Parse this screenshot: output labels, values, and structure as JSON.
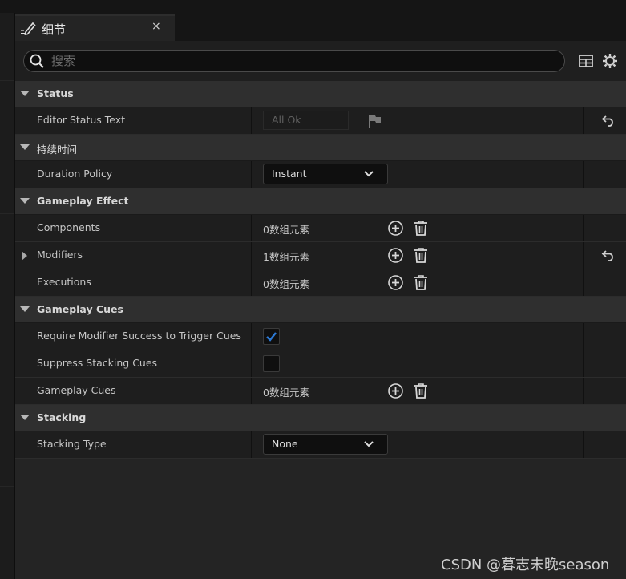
{
  "tab": {
    "title": "细节",
    "close": "×"
  },
  "search": {
    "placeholder": "搜索",
    "value": ""
  },
  "colors": {
    "checkbox_accent": "#2c7ad6"
  },
  "categories": {
    "status": {
      "label": "Status",
      "editor_status": {
        "name": "Editor Status Text",
        "value": "All Ok"
      }
    },
    "duration": {
      "label": "持续时间",
      "policy": {
        "name": "Duration Policy",
        "value": "Instant"
      }
    },
    "gameplay_effect": {
      "label": "Gameplay Effect",
      "components": {
        "name": "Components",
        "count": "0数组元素"
      },
      "modifiers": {
        "name": "Modifiers",
        "count": "1数组元素"
      },
      "executions": {
        "name": "Executions",
        "count": "0数组元素"
      }
    },
    "gameplay_cues": {
      "label": "Gameplay Cues",
      "require_modifier": {
        "name": "Require Modifier Success to Trigger Cues",
        "checked": true
      },
      "suppress_stacking": {
        "name": "Suppress Stacking Cues",
        "checked": false
      },
      "cues": {
        "name": "Gameplay Cues",
        "count": "0数组元素"
      }
    },
    "stacking": {
      "label": "Stacking",
      "type": {
        "name": "Stacking Type",
        "value": "None"
      }
    }
  },
  "watermark": "CSDN @暮志未晚season"
}
